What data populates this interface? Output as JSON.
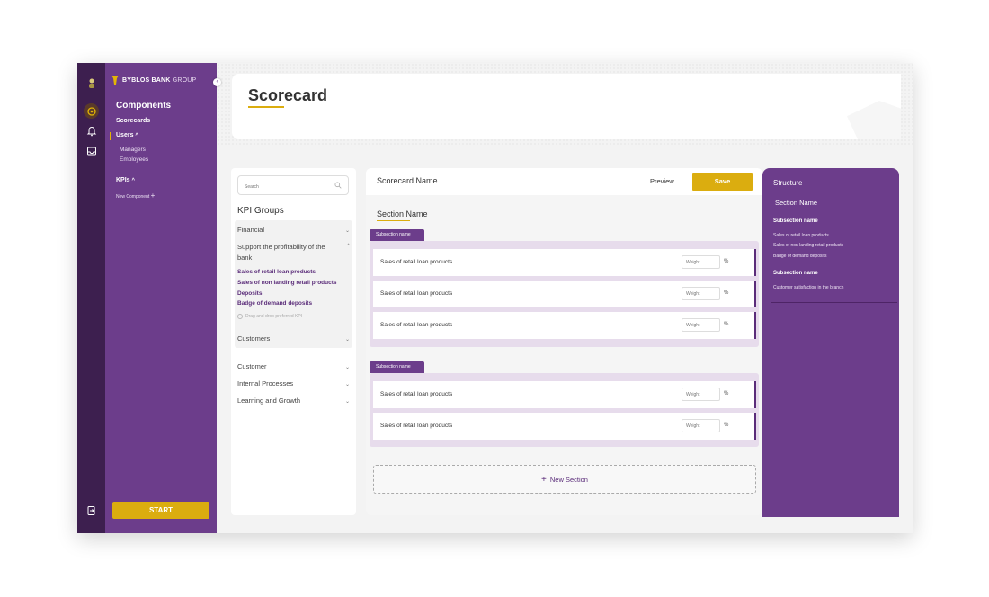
{
  "brand": {
    "name": "BYBLOS BANK",
    "suffix": "GROUP"
  },
  "nav": {
    "title": "Components",
    "scorecards": "Scorecards",
    "users": "Users",
    "users_sub": [
      "Managers",
      "Employees"
    ],
    "kpis": "KPIs",
    "new_component": "New Component",
    "start": "START"
  },
  "header": {
    "title": "Scorecard"
  },
  "kpi_panel": {
    "search_placeholder": "Search",
    "title": "KPI Groups",
    "groups": {
      "financial": "Financial",
      "support": "Support the profitability of the bank",
      "links": [
        "Sales of retail loan products",
        "Sales of non landing retail products",
        "Deposits",
        "Badge of demand deposits"
      ],
      "drag_hint": "Drag and drop preferred KPI",
      "customers": "Customers",
      "customer": "Customer",
      "internal": "Internal Processes",
      "learning": "Learning and Growth"
    }
  },
  "scorecard": {
    "name": "Scorecard Name",
    "preview": "Preview",
    "save": "Save",
    "section_name": "Section Name",
    "subsections": [
      {
        "label": "Subsection name",
        "rows": [
          "Sales of retail loan products",
          "Sales of retail loan products",
          "Sales of retail loan products"
        ]
      },
      {
        "label": "Subsection name",
        "rows": [
          "Sales of retail loan products",
          "Sales of retail loan products"
        ]
      }
    ],
    "weight_placeholder": "Weight",
    "pct": "%",
    "new_section": "New Section"
  },
  "structure": {
    "title": "Structure",
    "section_name": "Section Name",
    "sub1": "Subsection name",
    "sub1_items": [
      "Sales of retail loan products",
      "Sales of non landing retail products",
      "Badge of demand deposits"
    ],
    "sub2": "Subsection name",
    "sub2_items": [
      "Customer satisfaction in the branch"
    ]
  },
  "colors": {
    "primary_purple": "#6c3d8b",
    "dark_purple": "#3d1f4f",
    "gold": "#dbad0f"
  }
}
